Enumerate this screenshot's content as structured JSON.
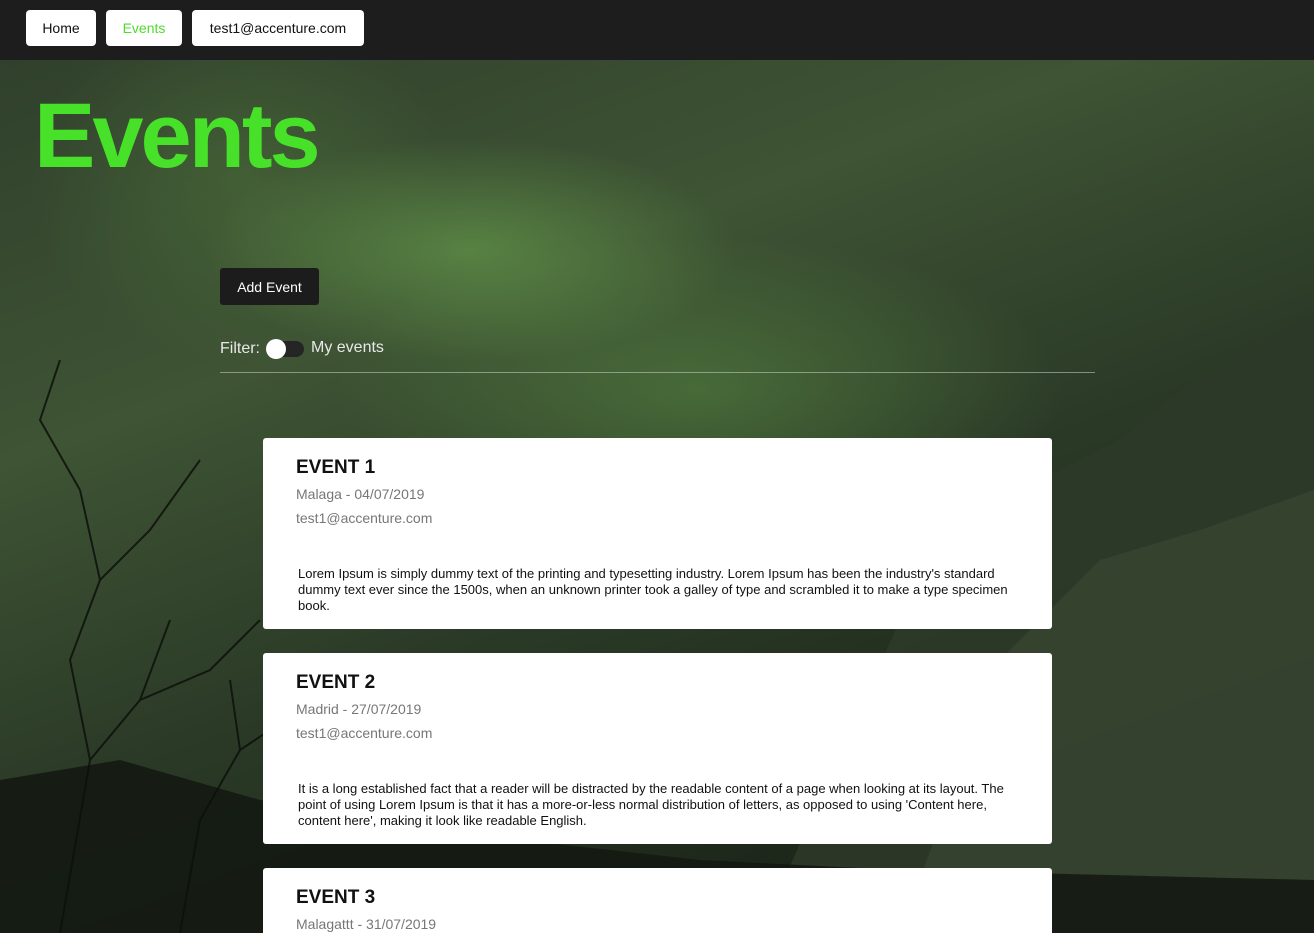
{
  "nav": {
    "home": "Home",
    "events": "Events",
    "user": "test1@accenture.com"
  },
  "page": {
    "title": "Events",
    "add_button": "Add Event",
    "filter_label": "Filter:",
    "toggle_label": "My events",
    "toggle_on": false
  },
  "events": [
    {
      "title": "EVENT 1",
      "meta": "Malaga - 04/07/2019",
      "author": "test1@accenture.com",
      "description": "Lorem Ipsum is simply dummy text of the printing and typesetting industry. Lorem Ipsum has been the industry's standard dummy text ever since the 1500s, when an unknown printer took a galley of type and scrambled it to make a type specimen book."
    },
    {
      "title": "EVENT 2",
      "meta": "Madrid - 27/07/2019",
      "author": "test1@accenture.com",
      "description": "It is a long established fact that a reader will be distracted by the readable content of a page when looking at its layout. The point of using Lorem Ipsum is that it has a more-or-less normal distribution of letters, as opposed to using 'Content here, content here', making it look like readable English."
    },
    {
      "title": "EVENT 3",
      "meta": "Malagattt - 31/07/2019"
    }
  ],
  "colors": {
    "accent": "#47e12a",
    "topbar": "#1d1d1d",
    "card": "#ffffff"
  }
}
